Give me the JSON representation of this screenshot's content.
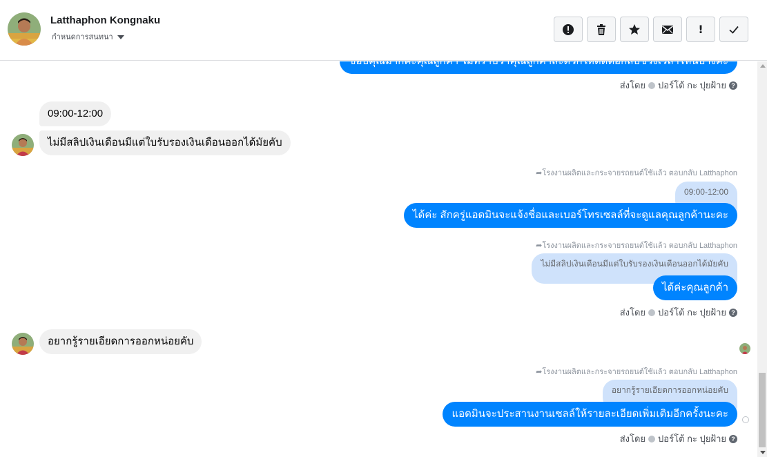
{
  "header": {
    "name": "Latthaphon Kongnaku",
    "subtitle": "กำหนดการสนทนา"
  },
  "toolbar": {
    "buttons": [
      {
        "icon": "alert-circle-icon"
      },
      {
        "icon": "trash-icon"
      },
      {
        "icon": "star-icon"
      },
      {
        "icon": "envelope-icon"
      },
      {
        "icon": "exclamation-icon",
        "label": "!"
      },
      {
        "icon": "checkmark-icon"
      }
    ]
  },
  "messages": {
    "top_out": "ขอบคุณมากค่ะคุณลูกค้า ไม่ทราบว่าคุณลูกค้าสะดวกให้ติดต่อกลับช่วงเวลาไหนบ้างคะ",
    "sent_by_1": "ส่งโดย",
    "sender_1": "ปอร์โต้ กะ ปุยฝ้าย",
    "in_1": "09:00-12:00",
    "in_2": "ไม่มีสลิปเงินเดือนมีแต่ใบรับรองเงินเดือนออกได้มัยคับ",
    "reply_1": "โรงงานผลิตและกระจายรถยนต์ใช้แล้ว ตอบกลับ Latthaphon",
    "quote_1": "09:00-12:00",
    "out_1": "ได้ค่ะ สักครู่แอดมินจะแจ้งชื่อและเบอร์โทรเซลล์ที่จะดูแลคุณลูกค้านะคะ",
    "reply_2": "โรงงานผลิตและกระจายรถยนต์ใช้แล้ว ตอบกลับ Latthaphon",
    "quote_2": "ไม่มีสลิปเงินเดือนมีแต่ใบรับรองเงินเดือนออกได้มัยคับ",
    "out_2": "ได้ค่ะคุณลูกค้า",
    "sent_by_2": "ส่งโดย",
    "sender_2": "ปอร์โต้ กะ ปุยฝ้าย",
    "in_3": "อยากรู้รายเอียดการออกหน่อยคับ",
    "reply_3": "โรงงานผลิตและกระจายรถยนต์ใช้แล้ว ตอบกลับ Latthaphon",
    "quote_3": "อยากรู้รายเอียดการออกหน่อยคับ",
    "out_3": "แอดมินจะประสานงานเซลล์ให้รายละเอียดเพิ่มเติมอีกครั้งนะคะ",
    "sent_by_3": "ส่งโดย",
    "sender_3": "ปอร์โต้ กะ ปุยฝ้าย"
  },
  "colors": {
    "outgoing": "#0084ff",
    "incoming": "#f0f0f0",
    "quote": "#cfe2fb"
  }
}
